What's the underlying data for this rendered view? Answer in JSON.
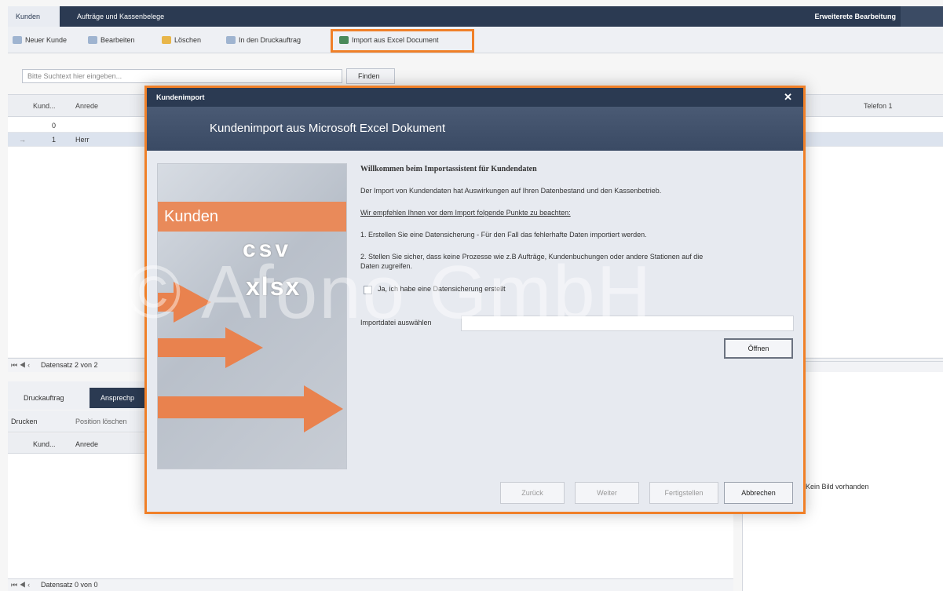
{
  "tabs": [
    "Kunden",
    "Aufträge und Kassenbelege"
  ],
  "tabbar_right": "Erweiterete Bearbeitung",
  "toolbar": {
    "new_customer": "Neuer Kunde",
    "edit": "Bearbeiten",
    "delete": "Löschen",
    "print_job": "In den Druckauftrag",
    "import_excel": "Import aus Excel Document"
  },
  "search": {
    "placeholder": "Bitte Suchtext hier eingeben...",
    "find_label": "Finden"
  },
  "grid": {
    "headers": [
      "Kund...",
      "Anrede",
      "Telefon 1"
    ],
    "rows": [
      {
        "num": "0",
        "salutation": ""
      },
      {
        "num": "1",
        "salutation": "Herr",
        "marker": "→"
      }
    ],
    "pager": "Datensatz 2 von 2"
  },
  "lower": {
    "tabs": [
      "Druckauftrag",
      "Ansprechp"
    ],
    "toolbar": {
      "print": "Drucken",
      "position": "Position löschen"
    },
    "headers": [
      "Kund...",
      "Anrede"
    ],
    "pager": "Datensatz 0 von 0",
    "no_image": "Kein Bild vorhanden"
  },
  "watermark": "© Afono GmbH",
  "dialog": {
    "title": "Kundenimport",
    "close": "✕",
    "header": "Kundenimport aus Microsoft Excel Dokument",
    "image": {
      "band": "Kunden",
      "csv": "csv",
      "xlsx": "xlsx"
    },
    "heading": "Willkommen beim Importassistent für Kundendaten",
    "intro": "Der Import von Kundendaten hat Auswirkungen auf Ihren Datenbestand und den Kassenbetrieb.",
    "recommend": "Wir empfehlen Ihnen vor dem Import folgende Punkte zu beachten:",
    "point1": "1. Erstellen Sie eine Datensicherung - Für den Fall das fehlerhafte Daten importiert werden.",
    "point2a": "2. Stellen Sie sicher, dass keine Prozesse wie z.B Aufträge, Kundenbuchungen oder andere Stationen auf die",
    "point2b": "Daten zugreifen.",
    "checkbox_label": "Ja, ich habe eine Datensicherung erstellt",
    "file_label": "Importdatei auswählen",
    "open_label": "Öffnen",
    "buttons": {
      "back": "Zurück",
      "next": "Weiter",
      "finish": "Fertigstellen",
      "cancel": "Abbrechen"
    }
  },
  "colors": {
    "navy": "#2b3a52",
    "highlight": "#f08028",
    "arrow": "#e9824e"
  }
}
